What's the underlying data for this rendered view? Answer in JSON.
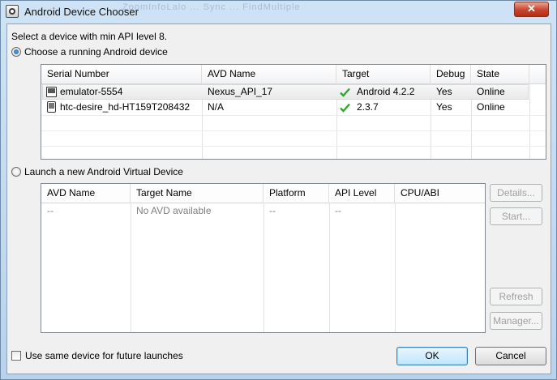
{
  "window": {
    "title": "Android Device Chooser",
    "background_title": "ZoomInfoLalo ... Sync ... FindMultiple",
    "close_glyph": "✕"
  },
  "header_text": "Select a device with min API level 8.",
  "running": {
    "radio_label": "Choose a running Android device",
    "selected": true,
    "columns": [
      "Serial Number",
      "AVD Name",
      "Target",
      "Debug",
      "State"
    ],
    "rows": [
      {
        "serial": "emulator-5554",
        "avd": "Nexus_API_17",
        "target": "Android 4.2.2",
        "debug": "Yes",
        "state": "Online",
        "icon": "emulator-icon",
        "selected": true
      },
      {
        "serial": "htc-desire_hd-HT159T208432",
        "avd": "N/A",
        "target": "2.3.7",
        "debug": "Yes",
        "state": "Online",
        "icon": "phone-icon",
        "selected": false
      }
    ]
  },
  "launch": {
    "radio_label": "Launch a new Android Virtual Device",
    "selected": false,
    "columns": [
      "AVD Name",
      "Target Name",
      "Platform",
      "API Level",
      "CPU/ABI"
    ],
    "rows": [
      {
        "avd": "--",
        "target": "No AVD available",
        "platform": "--",
        "api": "--",
        "cpu": ""
      }
    ],
    "buttons": {
      "details": "Details...",
      "start": "Start...",
      "refresh": "Refresh",
      "manager": "Manager..."
    }
  },
  "footer": {
    "checkbox_label": "Use same device for future launches",
    "checkbox_checked": false,
    "ok_label": "OK",
    "cancel_label": "Cancel"
  },
  "colors": {
    "check_green": "#2ea82e",
    "accent": "#3c7fb1"
  }
}
